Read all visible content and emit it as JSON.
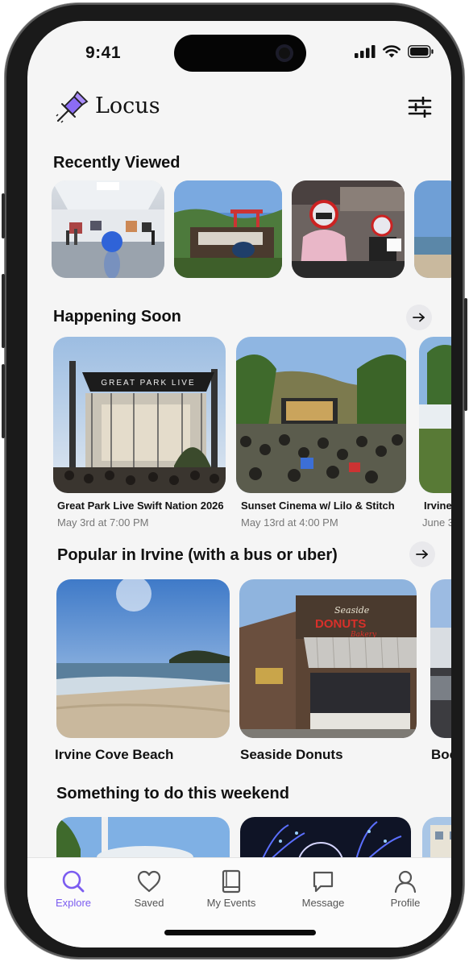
{
  "status_bar": {
    "time": "9:41"
  },
  "app": {
    "name": "Locus"
  },
  "sections": {
    "recent": {
      "title": "Recently Viewed"
    },
    "soon": {
      "title": "Happening Soon",
      "cards": [
        {
          "title": "Great Park Live Swift Nation 2026",
          "date": "May 3rd at 7:00 PM"
        },
        {
          "title": "Sunset Cinema w/ Lilo & Stitch",
          "date": "May 13rd at 4:00 PM"
        },
        {
          "title": "Irvine",
          "date": "June 3"
        }
      ]
    },
    "popular": {
      "title": "Popular in Irvine (with a bus or uber)",
      "cards": [
        {
          "title": "Irvine Cove Beach"
        },
        {
          "title": "Seaside Donuts"
        },
        {
          "title": "Boo"
        }
      ],
      "sign": {
        "line1": "Seaside",
        "line2": "DONUTS",
        "line3": "Bakery"
      }
    },
    "weekend": {
      "title": "Something to do this weekend"
    }
  },
  "stage_banner": "GREAT PARK LIVE",
  "tabbar": {
    "items": [
      {
        "label": "Explore",
        "icon": "search-icon",
        "active": true
      },
      {
        "label": "Saved",
        "icon": "heart-icon"
      },
      {
        "label": "My Events",
        "icon": "book-icon"
      },
      {
        "label": "Message",
        "icon": "message-icon"
      },
      {
        "label": "Profile",
        "icon": "user-icon"
      }
    ]
  },
  "colors": {
    "accent": "#7b5cf0",
    "background": "#f5f5f5",
    "tabbar": "#fbfbfb"
  }
}
